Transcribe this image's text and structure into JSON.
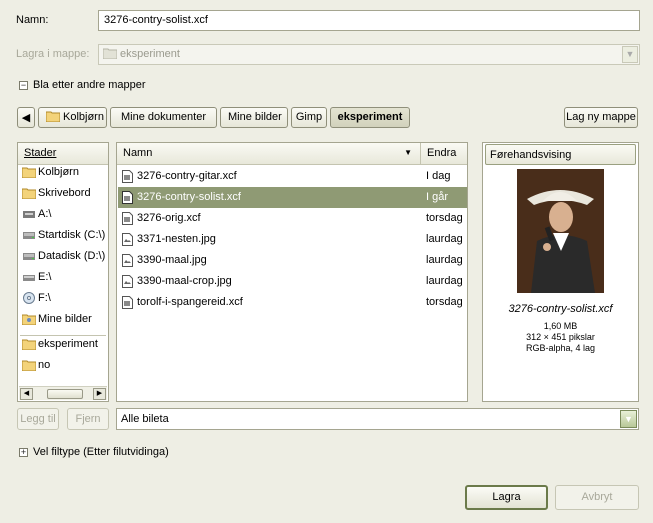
{
  "name_row": {
    "label": "Namn:",
    "value": "3276-contry-solist.xcf"
  },
  "folder_row": {
    "label": "Lagra i mappe:",
    "value": "eksperiment"
  },
  "browse_toggle": {
    "label": "Bla etter andre mapper"
  },
  "path_bar": {
    "buttons": [
      "Kolbjørn",
      "Mine dokumenter",
      "Mine bilder",
      "Gimp",
      "eksperiment"
    ],
    "new_folder_label": "Lag ny mappe"
  },
  "places": {
    "header": "Stader",
    "items": [
      {
        "label": "Kolbjørn",
        "icon": "home-folder-icon"
      },
      {
        "label": "Skrivebord",
        "icon": "desktop-folder-icon"
      },
      {
        "label": "A:\\",
        "icon": "floppy-drive-icon"
      },
      {
        "label": "Startdisk (C:\\)",
        "icon": "hard-disk-icon"
      },
      {
        "label": "Datadisk (D:\\)",
        "icon": "hard-disk-icon"
      },
      {
        "label": "E:\\",
        "icon": "cd-drive-icon"
      },
      {
        "label": "F:\\",
        "icon": "cd-drive-icon"
      },
      {
        "label": "Mine bilder",
        "icon": "pictures-folder-icon"
      },
      {
        "label": "eksperiment",
        "icon": "folder-icon"
      },
      {
        "label": "no",
        "icon": "folder-icon"
      }
    ],
    "add_label": "Legg til",
    "remove_label": "Fjern"
  },
  "files": {
    "col_name": "Namn",
    "col_modified": "Endra",
    "rows": [
      {
        "name": "3276-contry-gitar.xcf",
        "modified": "I dag",
        "selected": false
      },
      {
        "name": "3276-contry-solist.xcf",
        "modified": "I går",
        "selected": true
      },
      {
        "name": "3276-orig.xcf",
        "modified": "torsdag",
        "selected": false
      },
      {
        "name": "3371-nesten.jpg",
        "modified": "laurdag",
        "selected": false
      },
      {
        "name": "3390-maal.jpg",
        "modified": "laurdag",
        "selected": false
      },
      {
        "name": "3390-maal-crop.jpg",
        "modified": "laurdag",
        "selected": false
      },
      {
        "name": "torolf-i-spangereid.xcf",
        "modified": "torsdag",
        "selected": false
      }
    ]
  },
  "preview": {
    "header": "Førehandsvising",
    "filename": "3276-contry-solist.xcf",
    "size": "1,60 MB",
    "dimensions": "312 × 451 pikslar",
    "mode": "RGB-alpha, 4 lag"
  },
  "filter": {
    "value": "Alle bileta"
  },
  "filetype_toggle": {
    "label": "Vel filtype (Etter filutvidinga)"
  },
  "actions": {
    "save_label": "Lagra",
    "cancel_label": "Avbryt"
  },
  "colors": {
    "selection": "#8f9a74",
    "window_bg": "#eeeee4"
  }
}
